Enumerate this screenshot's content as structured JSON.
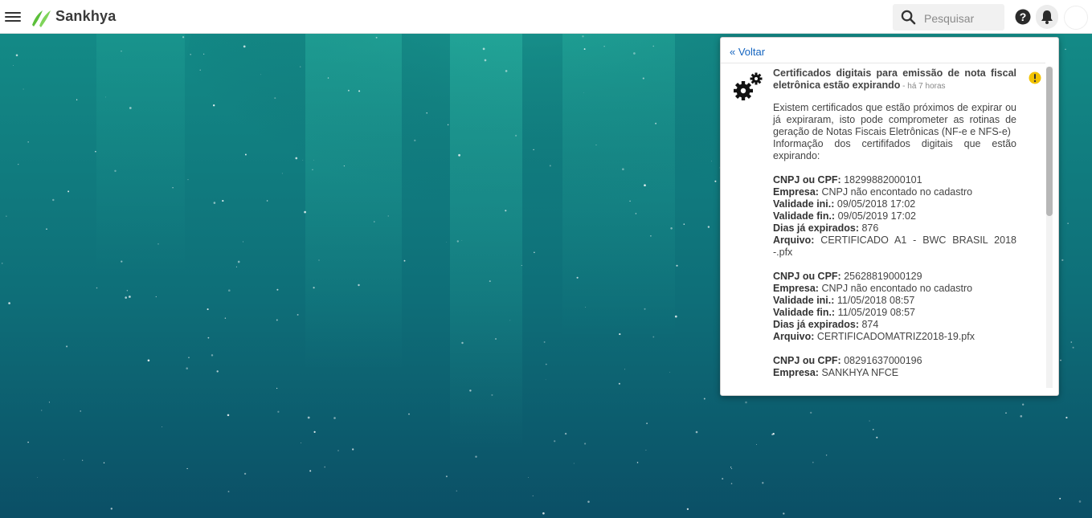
{
  "header": {
    "brand": "Sankhya",
    "search_placeholder": "Pesquisar",
    "icons": [
      "menu-icon",
      "sankhya-logo-icon",
      "search-icon",
      "help-icon",
      "bell-icon",
      "avatar"
    ]
  },
  "colors": {
    "brand_green": "#5bbf3a",
    "link_blue": "#1565c0",
    "warning_yellow": "#f2c300",
    "background_teal": "#0d5f6a"
  },
  "panel": {
    "back_label": "« Voltar",
    "notification": {
      "icon": "gears-icon",
      "status_icon": "warning-icon",
      "title": "Certificados digitais para emissão de nota fiscal eletrônica estão expirando",
      "time": " - há 7 horas",
      "intro_lines": [
        "Existem certificados que estão próximos de expirar ou já expiraram, isto pode comprometer as rotinas de geração de Notas Fiscais Eletrônicas (NF-e e NFS-e)",
        "Informação dos certififados digitais que estão expirando:"
      ],
      "labels": {
        "cnpj": "CNPJ ou CPF:",
        "empresa": "Empresa:",
        "validade_ini": "Validade ini.:",
        "validade_fin": "Validade fin.:",
        "dias": "Dias já expirados:",
        "arquivo": "Arquivo:"
      },
      "certificates": [
        {
          "cnpj": "18299882000101",
          "empresa": "CNPJ não encontado no cadastro",
          "validade_ini": "09/05/2018 17:02",
          "validade_fin": "09/05/2019 17:02",
          "dias": "876",
          "arquivo": "CERTIFICADO A1 - BWC BRASIL 2018 -.pfx"
        },
        {
          "cnpj": "25628819000129",
          "empresa": "CNPJ não encontado no cadastro",
          "validade_ini": "11/05/2018 08:57",
          "validade_fin": "11/05/2019 08:57",
          "dias": "874",
          "arquivo": "CERTIFICADOMATRIZ2018-19.pfx"
        },
        {
          "cnpj": "08291637000196",
          "empresa": "SANKHYA NFCE"
        }
      ]
    }
  }
}
